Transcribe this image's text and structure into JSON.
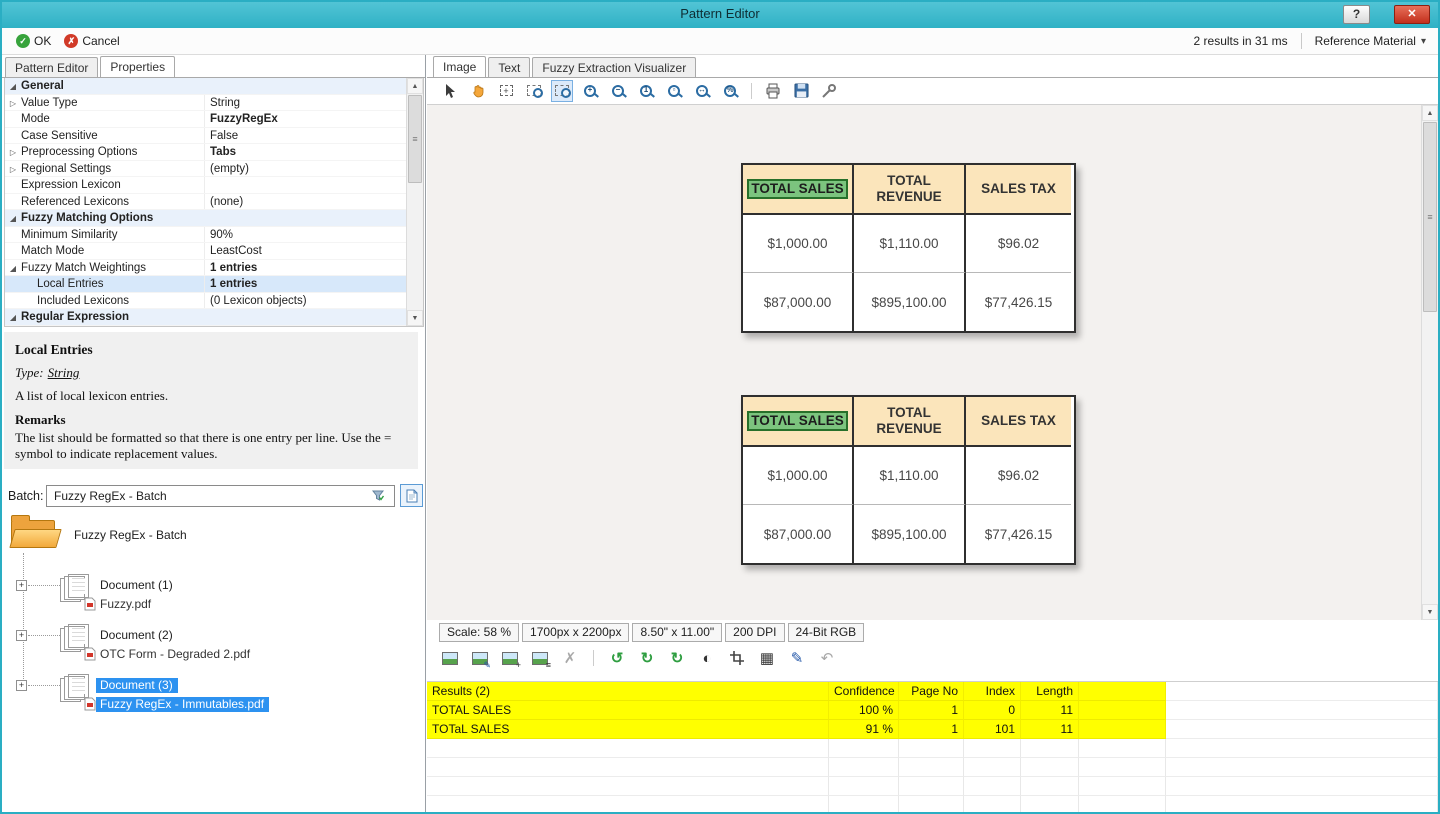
{
  "titlebar": {
    "title": "Pattern Editor",
    "help": "?",
    "close": "✕"
  },
  "cmdbar": {
    "ok": "OK",
    "cancel": "Cancel",
    "results_summary": "2 results in 31 ms",
    "reference_material": "Reference Material"
  },
  "left_tabs": {
    "pattern_editor": "Pattern Editor",
    "properties": "Properties"
  },
  "props": {
    "rows": [
      {
        "g": "◢",
        "label": "General",
        "value": ""
      },
      {
        "g": "▷",
        "label": "Value Type",
        "value": "String"
      },
      {
        "g": "",
        "label": "Mode",
        "value": "FuzzyRegEx"
      },
      {
        "g": "",
        "label": "Case Sensitive",
        "value": "False"
      },
      {
        "g": "▷",
        "label": "Preprocessing Options",
        "value": "Tabs"
      },
      {
        "g": "▷",
        "label": "Regional Settings",
        "value": "(empty)"
      },
      {
        "g": "",
        "label": "Expression Lexicon",
        "value": ""
      },
      {
        "g": "",
        "label": "Referenced Lexicons",
        "value": "(none)"
      },
      {
        "g": "◢",
        "label": "Fuzzy Matching Options",
        "value": ""
      },
      {
        "g": "",
        "label": "Minimum Similarity",
        "value": "90%"
      },
      {
        "g": "",
        "label": "Match Mode",
        "value": "LeastCost"
      },
      {
        "g": "◢",
        "label": "Fuzzy Match Weightings",
        "value": "1 entries"
      },
      {
        "g": "",
        "label": "Local Entries",
        "value": "1 entries"
      },
      {
        "g": "",
        "label": "Included Lexicons",
        "value": "(0 Lexicon objects)"
      },
      {
        "g": "◢",
        "label": "Regular Expression",
        "value": ""
      }
    ]
  },
  "help_box": {
    "title": "Local Entries",
    "type_label": "Type:",
    "type_value": "String",
    "body": "A list of local lexicon entries.",
    "remarks_label": "Remarks",
    "remarks": "The list should be formatted so that there is one entry per line. Use the = symbol to indicate replacement values."
  },
  "batch": {
    "label": "Batch:",
    "value": "Fuzzy RegEx - Batch"
  },
  "tree": {
    "root": "Fuzzy RegEx - Batch",
    "items": [
      {
        "title": "Document (1)",
        "file": "Fuzzy.pdf"
      },
      {
        "title": "Document (2)",
        "file": "OTC Form - Degraded 2.pdf"
      },
      {
        "title": "Document (3)",
        "file": "Fuzzy RegEx - Immutables.pdf"
      }
    ]
  },
  "right_tabs": {
    "image": "Image",
    "text": "Text",
    "fuzzy": "Fuzzy Extraction Visualizer"
  },
  "viewer": {
    "tables": [
      {
        "h0": "TOTAL SALES",
        "h1": "TOTAL REVENUE",
        "h2": "SALES TAX",
        "r0c0": "$1,000.00",
        "r0c1": "$1,110.00",
        "r0c2": "$96.02",
        "r1c0": "$87,000.00",
        "r1c1": "$895,100.00",
        "r1c2": "$77,426.15"
      },
      {
        "h0": "TOTΛL SALES",
        "h1": "TOTAL REVENUE",
        "h2": "SALES TAX",
        "r0c0": "$1,000.00",
        "r0c1": "$1,110.00",
        "r0c2": "$96.02",
        "r1c0": "$87,000.00",
        "r1c1": "$895,100.00",
        "r1c2": "$77,426.15"
      }
    ]
  },
  "statusbar": {
    "scale": "Scale: 58 %",
    "pixels": "1700px x 2200px",
    "inches": "8.50\" x 11.00\"",
    "dpi": "200 DPI",
    "depth": "24-Bit RGB"
  },
  "results": {
    "headers": {
      "name": "Results (2)",
      "confidence": "Confidence",
      "page": "Page No",
      "index": "Index",
      "length": "Length"
    },
    "rows": [
      {
        "name": "TOTAL SALES",
        "confidence": "100 %",
        "page": "1",
        "index": "0",
        "length": "11"
      },
      {
        "name": "TOTaL SALES",
        "confidence": "91 %",
        "page": "1",
        "index": "101",
        "length": "11"
      }
    ]
  },
  "glyphs": {
    "check": "✓",
    "cross": "✗",
    "up": "▲",
    "down": "▼",
    "grip": "≡",
    "plus": "+",
    "caret": "▾",
    "back": "↺",
    "forward": "↻",
    "refresh": "↻",
    "contrast": "◐",
    "grid": "▦",
    "pen": "✎",
    "undo": "↶",
    "delete": "✗",
    "zoom_in": "+",
    "zoom_out": "−",
    "zoom_actual": "1",
    "zoom_fit": "▫",
    "zoom_width": "↔",
    "zoom_percent": "%"
  },
  "colors": {
    "titlebar": "#35b4c8",
    "result_highlight": "#ffff00",
    "tree_selection": "#2d92f0",
    "match_highlight": "#7cc47e",
    "table_header": "#fbe5bb"
  }
}
